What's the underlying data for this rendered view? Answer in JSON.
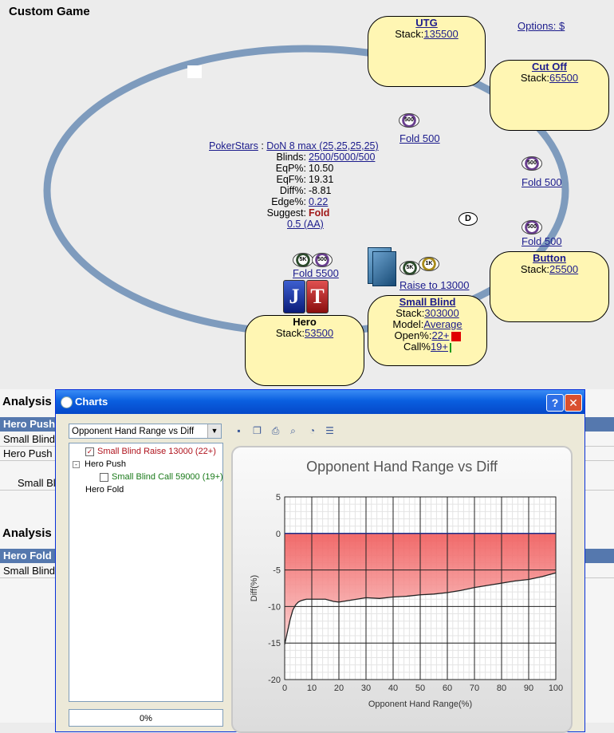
{
  "window": {
    "title": "Custom Game"
  },
  "options_link": "Options: $",
  "seats": {
    "utg": {
      "name": "UTG",
      "stack_label": "Stack:",
      "stack": "135500"
    },
    "cutoff": {
      "name": "Cut Off",
      "stack_label": "Stack:",
      "stack": "65500"
    },
    "button": {
      "name": "Button",
      "stack_label": "Stack:",
      "stack": "25500"
    },
    "small_blind": {
      "name": "Small Blind",
      "stack_label": "Stack:",
      "stack": "303000",
      "model_label": "Model:",
      "model": "Average",
      "open_label": "Open%:",
      "open": "22+",
      "call_label": "Call%",
      "call": "19+"
    },
    "hero": {
      "name": "Hero",
      "stack_label": "Stack:",
      "stack": "53500",
      "cards": [
        "J",
        "T"
      ]
    }
  },
  "actions": {
    "utg_fold": "Fold 500",
    "cutoff_fold": "Fold 500",
    "button_fold": "Fold 500",
    "hero_fold": "Fold 5500",
    "sb_raise": "Raise to 13000"
  },
  "chips": {
    "c500": "500",
    "c5k": "5K",
    "c1k": "1K"
  },
  "dealer_button": "D",
  "info": {
    "site": "PokerStars",
    "sep": ":",
    "game": "DoN 8 max (25,25,25,25)",
    "blinds_label": "Blinds:",
    "blinds": "2500/5000/500",
    "eqp_label": "EqP%:",
    "eqp": "10.50",
    "eqf_label": "EqF%:",
    "eqf": "19.31",
    "diff_label": "Diff%:",
    "diff": "-8.81",
    "edge_label": "Edge%:",
    "edge": "0.22",
    "suggest_label": "Suggest:",
    "suggest": "Fold",
    "extra": "0.5 (AA)"
  },
  "analysis_bg": {
    "heading1": "Analysis",
    "bar1": "Hero Push",
    "row1": "Small Blind",
    "row2": "Hero Push",
    "row3": "Small Bl",
    "heading2": "Analysis",
    "bar2": "Hero Fold",
    "row4": "Small Blind"
  },
  "dialog": {
    "title": "Charts",
    "help": "?",
    "close": "✕",
    "combo_value": "Opponent Hand Range vs Diff",
    "tree": {
      "item1": "Small Blind Raise 13000 (22+)",
      "item2": "Hero Push",
      "item3": "Small Blind Call 59000 (19+)",
      "item4": "Hero Fold"
    },
    "progress": "0%"
  },
  "colors": {
    "felt": "#7e9bbd",
    "seat": "#fff6b3",
    "titlebar": "#0a5fe0",
    "area": "#f05a5a",
    "suggest": "#a01818"
  },
  "chart_data": {
    "type": "area",
    "title": "Opponent Hand Range vs Diff",
    "xlabel": "Opponent Hand Range(%)",
    "ylabel": "Diff(%)",
    "xlim": [
      0,
      100
    ],
    "ylim": [
      -20,
      5
    ],
    "xticks": [
      0,
      10,
      20,
      30,
      40,
      50,
      60,
      70,
      80,
      90,
      100
    ],
    "yticks": [
      5,
      0,
      -5,
      -10,
      -15,
      -20
    ],
    "grid": true,
    "x": [
      0,
      1,
      2,
      3,
      4,
      5,
      6,
      8,
      10,
      12,
      15,
      18,
      20,
      25,
      30,
      35,
      40,
      45,
      50,
      55,
      60,
      65,
      70,
      75,
      80,
      85,
      90,
      95,
      100
    ],
    "y": [
      -15.2,
      -13.5,
      -11.8,
      -10.5,
      -9.8,
      -9.4,
      -9.2,
      -9.0,
      -9.0,
      -9.0,
      -9.0,
      -9.3,
      -9.4,
      -9.1,
      -8.8,
      -8.9,
      -8.7,
      -8.6,
      -8.4,
      -8.3,
      -8.1,
      -7.8,
      -7.4,
      -7.1,
      -6.8,
      -6.5,
      -6.3,
      -5.9,
      -5.4
    ]
  }
}
